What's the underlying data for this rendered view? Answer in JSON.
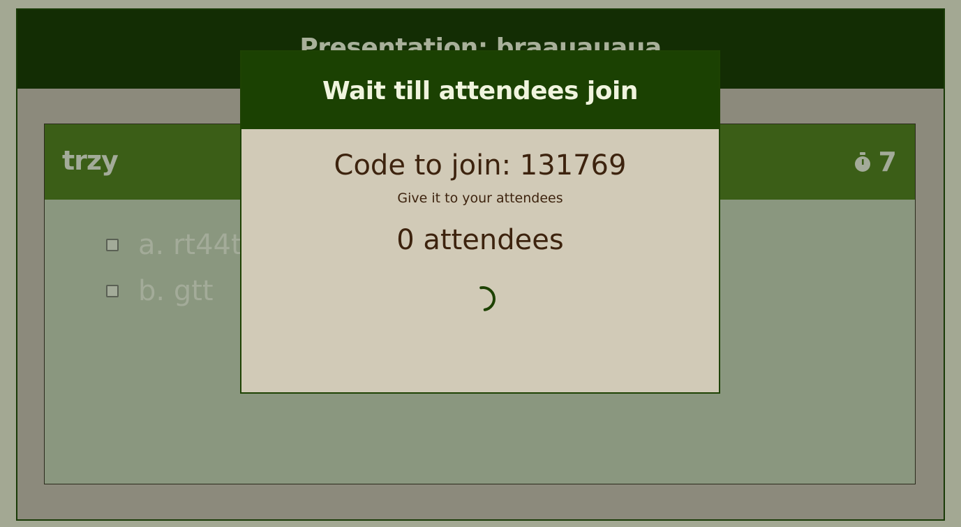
{
  "presentation": {
    "title": "Presentation: braauauaua"
  },
  "question": {
    "title": "trzy",
    "timer_value": "7",
    "timer_icon": "stopwatch-icon",
    "answers": [
      {
        "label": "a. rt44t",
        "checked": false
      },
      {
        "label": "b. gtt",
        "checked": false
      }
    ]
  },
  "modal": {
    "title": "Wait till attendees join",
    "join_code_text": "Code to join: 131769",
    "hint": "Give it to your attendees",
    "attendees_text": "0 attendees",
    "spinner_icon": "loading-spinner-icon"
  },
  "colors": {
    "header_dark": "#132d04",
    "question_header": "#3b5e17",
    "modal_header": "#1b4102",
    "modal_body": "#d1cab7",
    "text_brown": "#3d230e",
    "spinner": "#1e4203"
  }
}
